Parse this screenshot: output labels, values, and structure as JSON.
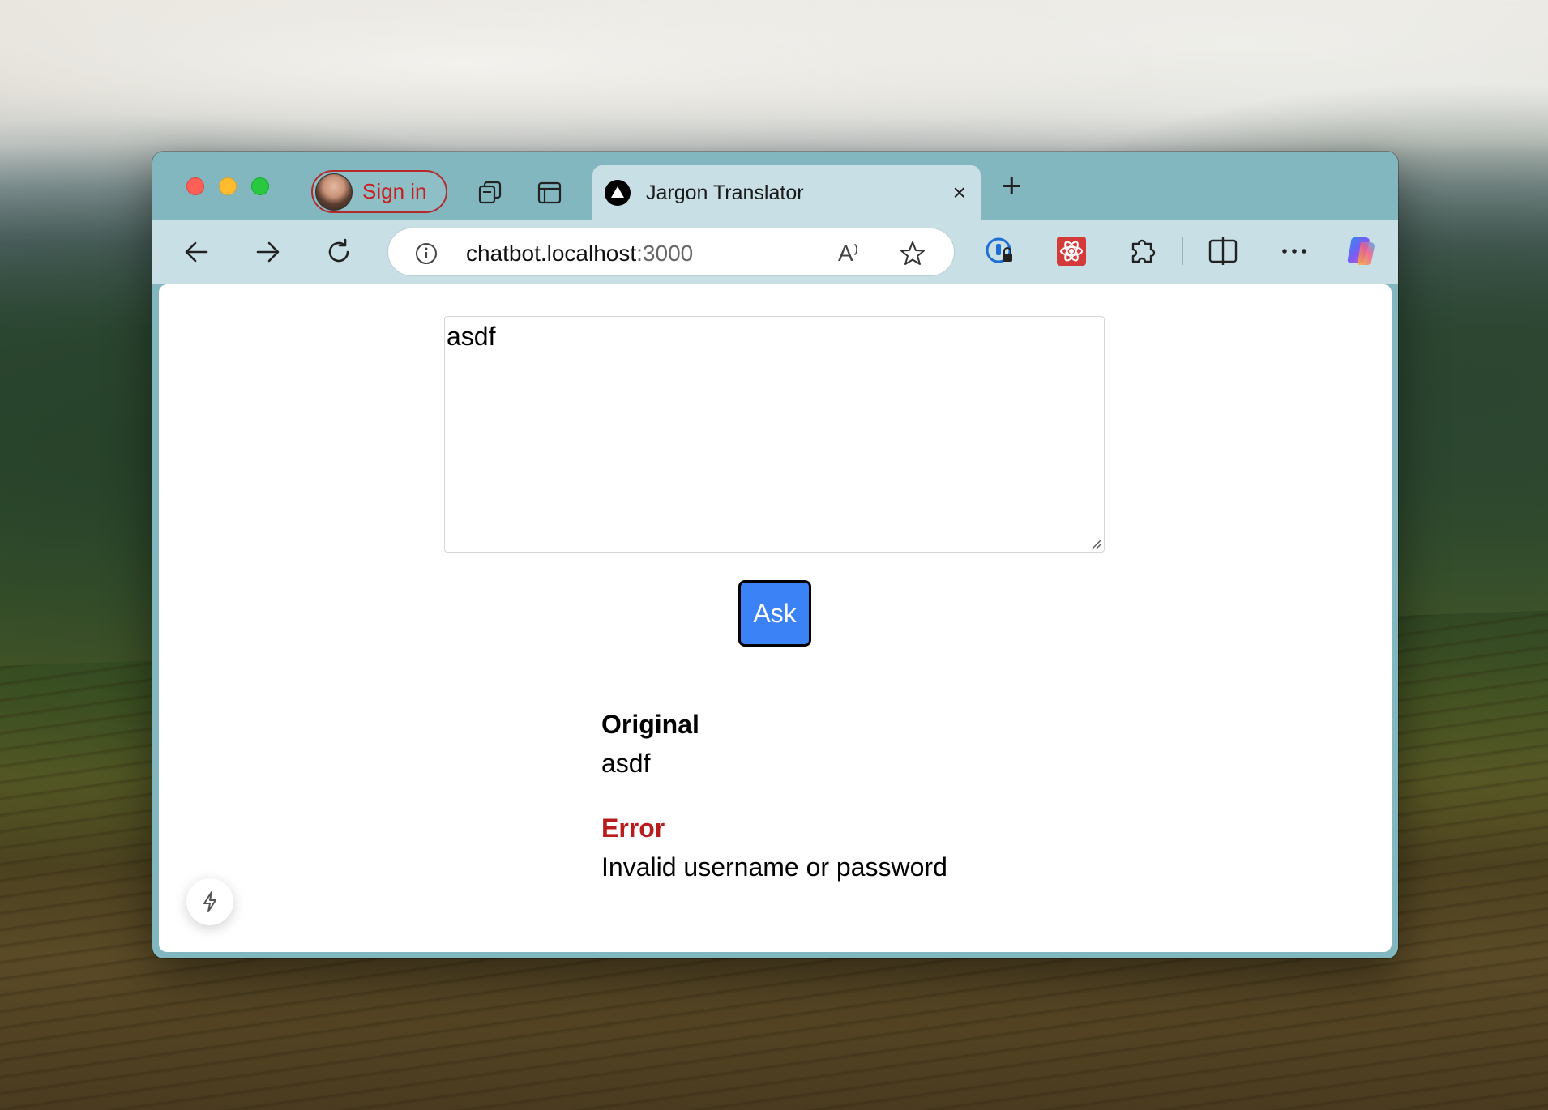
{
  "browser": {
    "profile": {
      "sign_in_label": "Sign in"
    },
    "tab": {
      "title": "Jargon Translator",
      "close_glyph": "×"
    },
    "new_tab_glyph": "+",
    "address": {
      "host": "chatbot.localhost",
      "port": ":3000",
      "read_aloud_label": "A⁾"
    }
  },
  "page": {
    "prompt_value": "asdf",
    "ask_label": "Ask",
    "original": {
      "label": "Original",
      "value": "asdf"
    },
    "error": {
      "label": "Error",
      "value": "Invalid username or password"
    }
  },
  "icons": [
    "workspaces-icon",
    "tab-actions-icon",
    "back-icon",
    "forward-icon",
    "refresh-icon",
    "info-icon",
    "read-aloud-icon",
    "favorite-star-icon",
    "password-manager-icon",
    "react-devtools-icon",
    "extensions-icon",
    "split-screen-icon",
    "more-icon",
    "copilot-icon",
    "bolt-icon"
  ],
  "colors": {
    "error": "#b91c1c",
    "ask_button": "#3b82f6",
    "sign_in": "#c81e1e",
    "browser_frame": "#82b7c0",
    "toolbar": "#c8e0e5"
  }
}
